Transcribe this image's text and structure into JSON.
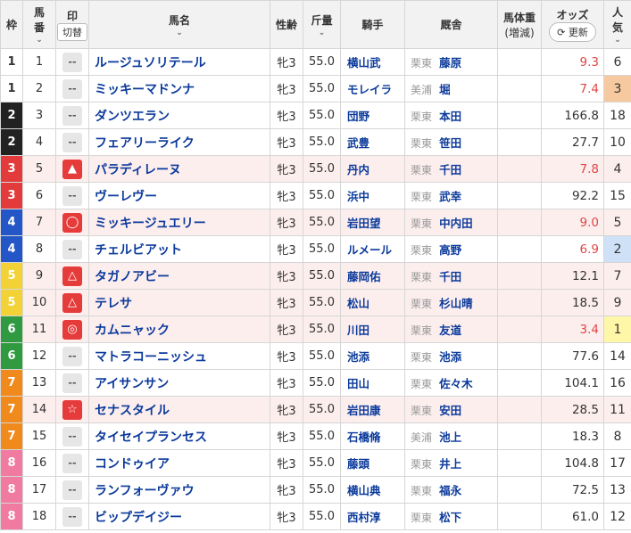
{
  "header": {
    "waku": "枠",
    "umaban": "馬\n番",
    "umaban_1": "馬",
    "umaban_2": "番",
    "mark": "印",
    "mark_toggle": "切替",
    "horse": "馬名",
    "sexage": "性齢",
    "kinryo": "斤量",
    "jockey": "騎手",
    "stable": "厩舎",
    "weight_1": "馬体重",
    "weight_2": "(増減)",
    "odds": "オッズ",
    "refresh": "更新",
    "ninki_1": "人",
    "ninki_2": "気",
    "chev": "⌄"
  },
  "colors": {
    "waku": {
      "1": "#ffffff",
      "2": "#222222",
      "3": "#e33b3b",
      "4": "#2456c7",
      "5": "#f2d236",
      "6": "#2f9a3f",
      "7": "#f08a1d",
      "8": "#f07aa0"
    },
    "waku_text": {
      "1": "#333333",
      "2": "#ffffff",
      "3": "#ffffff",
      "4": "#ffffff",
      "5": "#ffffff",
      "6": "#ffffff",
      "7": "#ffffff",
      "8": "#ffffff"
    },
    "ninki_bg": {
      "1": "#fff7a8",
      "2": "#cfe1f7",
      "3": "#f7c9a0"
    }
  },
  "rows": [
    {
      "waku": "1",
      "umaban": "1",
      "mark": "--",
      "mark_icon": "none",
      "horse": "ルージュソリテール",
      "sex": "牝3",
      "kin": "55.0",
      "jockey": "横山武",
      "region": "栗東",
      "trainer": "藤原",
      "weight": "",
      "odds": "9.3",
      "hot": true,
      "ninki": "6",
      "hl": false
    },
    {
      "waku": "1",
      "umaban": "2",
      "mark": "--",
      "mark_icon": "none",
      "horse": "ミッキーマドンナ",
      "sex": "牝3",
      "kin": "55.0",
      "jockey": "モレイラ",
      "region": "美浦",
      "trainer": "堀",
      "weight": "",
      "odds": "7.4",
      "hot": true,
      "ninki": "3",
      "hl": false
    },
    {
      "waku": "2",
      "umaban": "3",
      "mark": "--",
      "mark_icon": "none",
      "horse": "ダンツエラン",
      "sex": "牝3",
      "kin": "55.0",
      "jockey": "団野",
      "region": "栗東",
      "trainer": "本田",
      "weight": "",
      "odds": "166.8",
      "hot": false,
      "ninki": "18",
      "hl": false
    },
    {
      "waku": "2",
      "umaban": "4",
      "mark": "--",
      "mark_icon": "none",
      "horse": "フェアリーライク",
      "sex": "牝3",
      "kin": "55.0",
      "jockey": "武豊",
      "region": "栗東",
      "trainer": "笹田",
      "weight": "",
      "odds": "27.7",
      "hot": false,
      "ninki": "10",
      "hl": false
    },
    {
      "waku": "3",
      "umaban": "5",
      "mark": "▲",
      "mark_icon": "filled-triangle",
      "horse": "パラディレーヌ",
      "sex": "牝3",
      "kin": "55.0",
      "jockey": "丹内",
      "region": "栗東",
      "trainer": "千田",
      "weight": "",
      "odds": "7.8",
      "hot": true,
      "ninki": "4",
      "hl": true
    },
    {
      "waku": "3",
      "umaban": "6",
      "mark": "--",
      "mark_icon": "none",
      "horse": "ヴーレヴー",
      "sex": "牝3",
      "kin": "55.0",
      "jockey": "浜中",
      "region": "栗東",
      "trainer": "武幸",
      "weight": "",
      "odds": "92.2",
      "hot": false,
      "ninki": "15",
      "hl": false
    },
    {
      "waku": "4",
      "umaban": "7",
      "mark": "◯",
      "mark_icon": "circle",
      "horse": "ミッキージュエリー",
      "sex": "牝3",
      "kin": "55.0",
      "jockey": "岩田望",
      "region": "栗東",
      "trainer": "中内田",
      "weight": "",
      "odds": "9.0",
      "hot": true,
      "ninki": "5",
      "hl": true
    },
    {
      "waku": "4",
      "umaban": "8",
      "mark": "--",
      "mark_icon": "none",
      "horse": "チェルビアット",
      "sex": "牝3",
      "kin": "55.0",
      "jockey": "ルメール",
      "region": "栗東",
      "trainer": "高野",
      "weight": "",
      "odds": "6.9",
      "hot": true,
      "ninki": "2",
      "hl": false
    },
    {
      "waku": "5",
      "umaban": "9",
      "mark": "△",
      "mark_icon": "open-triangle",
      "horse": "タガノアビー",
      "sex": "牝3",
      "kin": "55.0",
      "jockey": "藤岡佑",
      "region": "栗東",
      "trainer": "千田",
      "weight": "",
      "odds": "12.1",
      "hot": false,
      "ninki": "7",
      "hl": true
    },
    {
      "waku": "5",
      "umaban": "10",
      "mark": "△",
      "mark_icon": "open-triangle",
      "horse": "テレサ",
      "sex": "牝3",
      "kin": "55.0",
      "jockey": "松山",
      "region": "栗東",
      "trainer": "杉山晴",
      "weight": "",
      "odds": "18.5",
      "hot": false,
      "ninki": "9",
      "hl": true
    },
    {
      "waku": "6",
      "umaban": "11",
      "mark": "◎",
      "mark_icon": "double-circle",
      "horse": "カムニャック",
      "sex": "牝3",
      "kin": "55.0",
      "jockey": "川田",
      "region": "栗東",
      "trainer": "友道",
      "weight": "",
      "odds": "3.4",
      "hot": true,
      "ninki": "1",
      "hl": true
    },
    {
      "waku": "6",
      "umaban": "12",
      "mark": "--",
      "mark_icon": "none",
      "horse": "マトラコーニッシュ",
      "sex": "牝3",
      "kin": "55.0",
      "jockey": "池添",
      "region": "栗東",
      "trainer": "池添",
      "weight": "",
      "odds": "77.6",
      "hot": false,
      "ninki": "14",
      "hl": false
    },
    {
      "waku": "7",
      "umaban": "13",
      "mark": "--",
      "mark_icon": "none",
      "horse": "アイサンサン",
      "sex": "牝3",
      "kin": "55.0",
      "jockey": "田山",
      "region": "栗東",
      "trainer": "佐々木",
      "weight": "",
      "odds": "104.1",
      "hot": false,
      "ninki": "16",
      "hl": false
    },
    {
      "waku": "7",
      "umaban": "14",
      "mark": "☆",
      "mark_icon": "star",
      "horse": "セナスタイル",
      "sex": "牝3",
      "kin": "55.0",
      "jockey": "岩田康",
      "region": "栗東",
      "trainer": "安田",
      "weight": "",
      "odds": "28.5",
      "hot": false,
      "ninki": "11",
      "hl": true
    },
    {
      "waku": "7",
      "umaban": "15",
      "mark": "--",
      "mark_icon": "none",
      "horse": "タイセイプランセス",
      "sex": "牝3",
      "kin": "55.0",
      "jockey": "石橋脩",
      "region": "美浦",
      "trainer": "池上",
      "weight": "",
      "odds": "18.3",
      "hot": false,
      "ninki": "8",
      "hl": false
    },
    {
      "waku": "8",
      "umaban": "16",
      "mark": "--",
      "mark_icon": "none",
      "horse": "コンドゥイア",
      "sex": "牝3",
      "kin": "55.0",
      "jockey": "藤頭",
      "region": "栗東",
      "trainer": "井上",
      "weight": "",
      "odds": "104.8",
      "hot": false,
      "ninki": "17",
      "hl": false
    },
    {
      "waku": "8",
      "umaban": "17",
      "mark": "--",
      "mark_icon": "none",
      "horse": "ランフォーヴァウ",
      "sex": "牝3",
      "kin": "55.0",
      "jockey": "横山典",
      "region": "栗東",
      "trainer": "福永",
      "weight": "",
      "odds": "72.5",
      "hot": false,
      "ninki": "13",
      "hl": false
    },
    {
      "waku": "8",
      "umaban": "18",
      "mark": "--",
      "mark_icon": "none",
      "horse": "ビップデイジー",
      "sex": "牝3",
      "kin": "55.0",
      "jockey": "西村淳",
      "region": "栗東",
      "trainer": "松下",
      "weight": "",
      "odds": "61.0",
      "hot": false,
      "ninki": "12",
      "hl": false
    }
  ]
}
